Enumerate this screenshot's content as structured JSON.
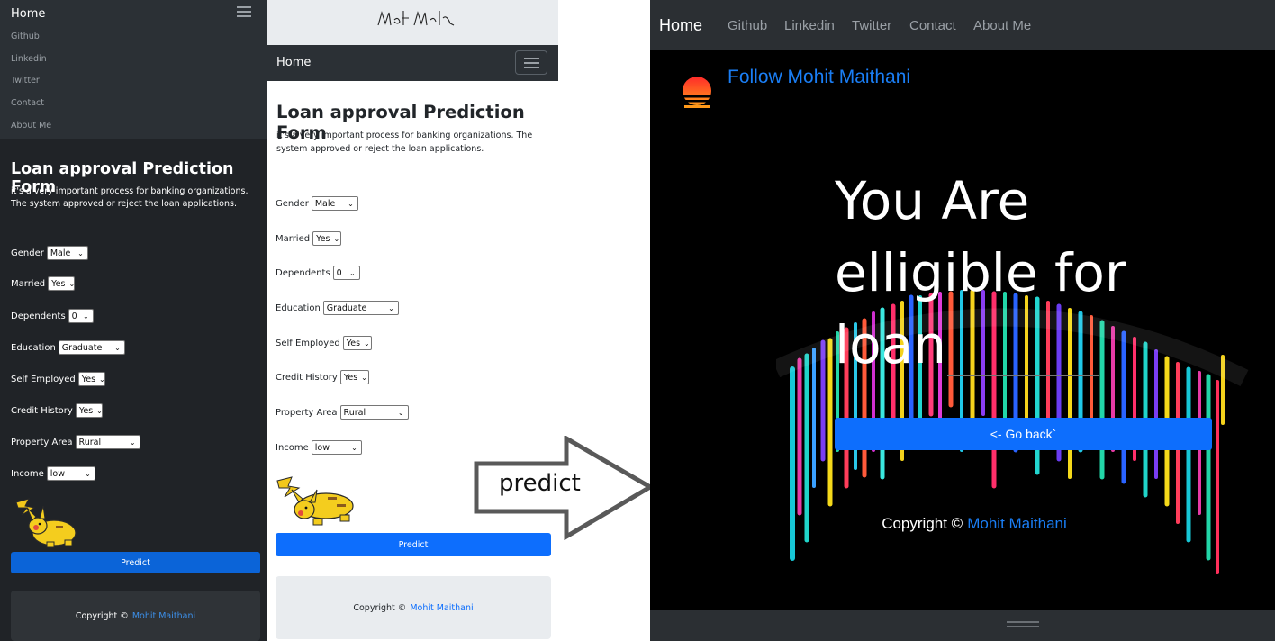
{
  "left_form": {
    "nav": {
      "home": "Home",
      "links": [
        "Github",
        "Linkedin",
        "Twitter",
        "Contact",
        "About Me"
      ]
    },
    "title": "Loan approval Prediction Form",
    "description": "it's a very important process for banking organizations. The system approved or reject the loan applications.",
    "fields": [
      {
        "label": "Gender",
        "value": "Male"
      },
      {
        "label": "Married",
        "value": "Yes"
      },
      {
        "label": "Dependents",
        "value": "0"
      },
      {
        "label": "Education",
        "value": "Graduate"
      },
      {
        "label": "Self Employed",
        "value": "Yes"
      },
      {
        "label": "Credit History",
        "value": "Yes"
      },
      {
        "label": "Property Area",
        "value": "Rural"
      },
      {
        "label": "Income",
        "value": "low"
      }
    ],
    "predict_label": "Predict",
    "footer_text": "Copyright ©",
    "footer_link": "Mohit Maithani"
  },
  "middle_form": {
    "nav_home": "Home",
    "title": "Loan approval Prediction Form",
    "description": "it's a very important process for banking organizations. The system approved or reject the loan applications.",
    "fields": [
      {
        "label": "Gender",
        "value": "Male"
      },
      {
        "label": "Married",
        "value": "Yes"
      },
      {
        "label": "Dependents",
        "value": "0"
      },
      {
        "label": "Education",
        "value": "Graduate"
      },
      {
        "label": "Self Employed",
        "value": "Yes"
      },
      {
        "label": "Credit History",
        "value": "Yes"
      },
      {
        "label": "Property Area",
        "value": "Rural"
      },
      {
        "label": "Income",
        "value": "low"
      }
    ],
    "predict_label": "Predict",
    "footer_text": "Copyright ©",
    "footer_link": "Mohit Maithani"
  },
  "arrow_label": "predict",
  "result_page": {
    "nav": {
      "home": "Home",
      "links": [
        "Github",
        "Linkedin",
        "Twitter",
        "Contact",
        "About Me"
      ]
    },
    "follow_text": "Follow Mohit Maithani",
    "result_line1": "You Are",
    "result_line2": "elligible for",
    "result_line3": "loan",
    "go_back_label": "<- Go back`",
    "footer_text": "Copyright ©",
    "footer_link": "Mohit Maithani"
  },
  "colors": {
    "primary": "#0d6efd",
    "dark_nav": "#2b3035",
    "link_blue": "#1a7ef5"
  }
}
